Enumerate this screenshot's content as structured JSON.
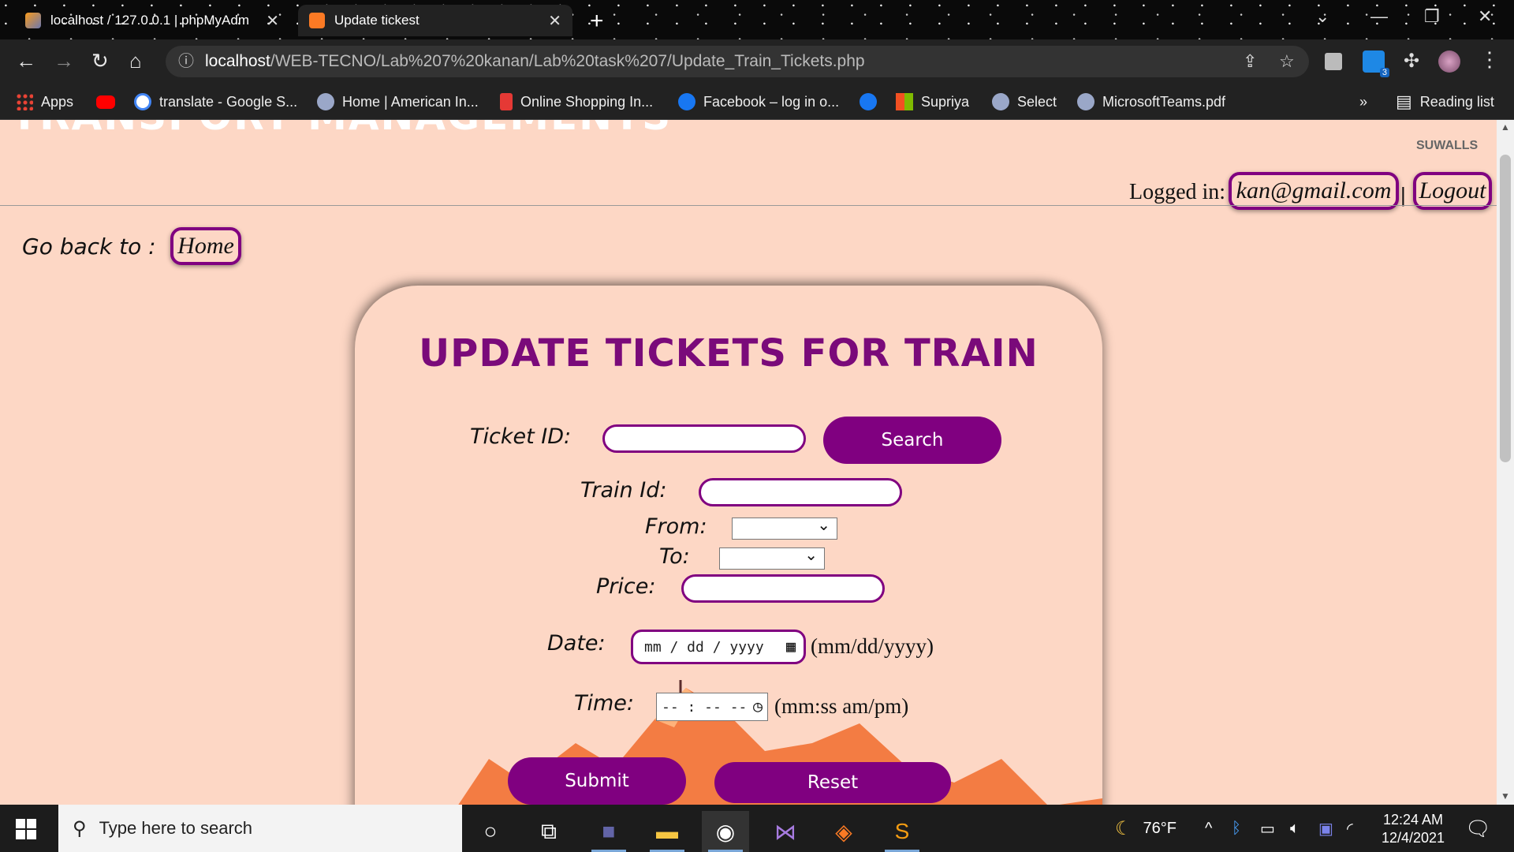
{
  "browser": {
    "tabs": [
      {
        "title": "localhost / 127.0.0.1 | phpMyAdm",
        "active": false
      },
      {
        "title": "Update tickest",
        "active": true
      }
    ],
    "url_host": "localhost",
    "url_path": "/WEB-TECNO/Lab%207%20kanan/Lab%20task%207/Update_Train_Tickets.php",
    "bookmarks": [
      {
        "label": "Apps"
      },
      {
        "label": ""
      },
      {
        "label": "translate - Google S..."
      },
      {
        "label": "Home | American In..."
      },
      {
        "label": "Online Shopping In..."
      },
      {
        "label": "Facebook – log in o..."
      },
      {
        "label": ""
      },
      {
        "label": "Supriya"
      },
      {
        "label": "Select"
      },
      {
        "label": "MicrosoftTeams.pdf"
      }
    ],
    "bookmarks_overflow": "»",
    "reading_list": "Reading list",
    "extension_badge": "3"
  },
  "page": {
    "site_title": "TRANSPORT MANAGEMENTS",
    "watermark": "SUWALLS",
    "logged_in_label": "Logged in:",
    "user_email": "kan@gmail.com",
    "separator": "|",
    "logout": "Logout",
    "go_back_label": "Go back to :",
    "home_link": "Home"
  },
  "form": {
    "title": "UPDATE TICKETS FOR TRAIN",
    "ticket_id_label": "Ticket ID:",
    "search_button": "Search",
    "train_id_label": "Train Id:",
    "from_label": "From:",
    "to_label": "To:",
    "price_label": "Price:",
    "date_label": "Date:",
    "date_placeholder": "mm / dd / yyyy",
    "date_hint": "(mm/dd/yyyy)",
    "time_label": "Time:",
    "time_placeholder": "-- : --  --",
    "time_hint": "(mm:ss am/pm)",
    "submit_button": "Submit",
    "reset_button": "Reset"
  },
  "taskbar": {
    "search_placeholder": "Type here to search",
    "weather": "76°F",
    "time": "12:24 AM",
    "date": "12/4/2021"
  },
  "colors": {
    "accent_purple": "#800080",
    "page_background": "#fdd7c5",
    "title_purple": "#7a0a7a"
  }
}
